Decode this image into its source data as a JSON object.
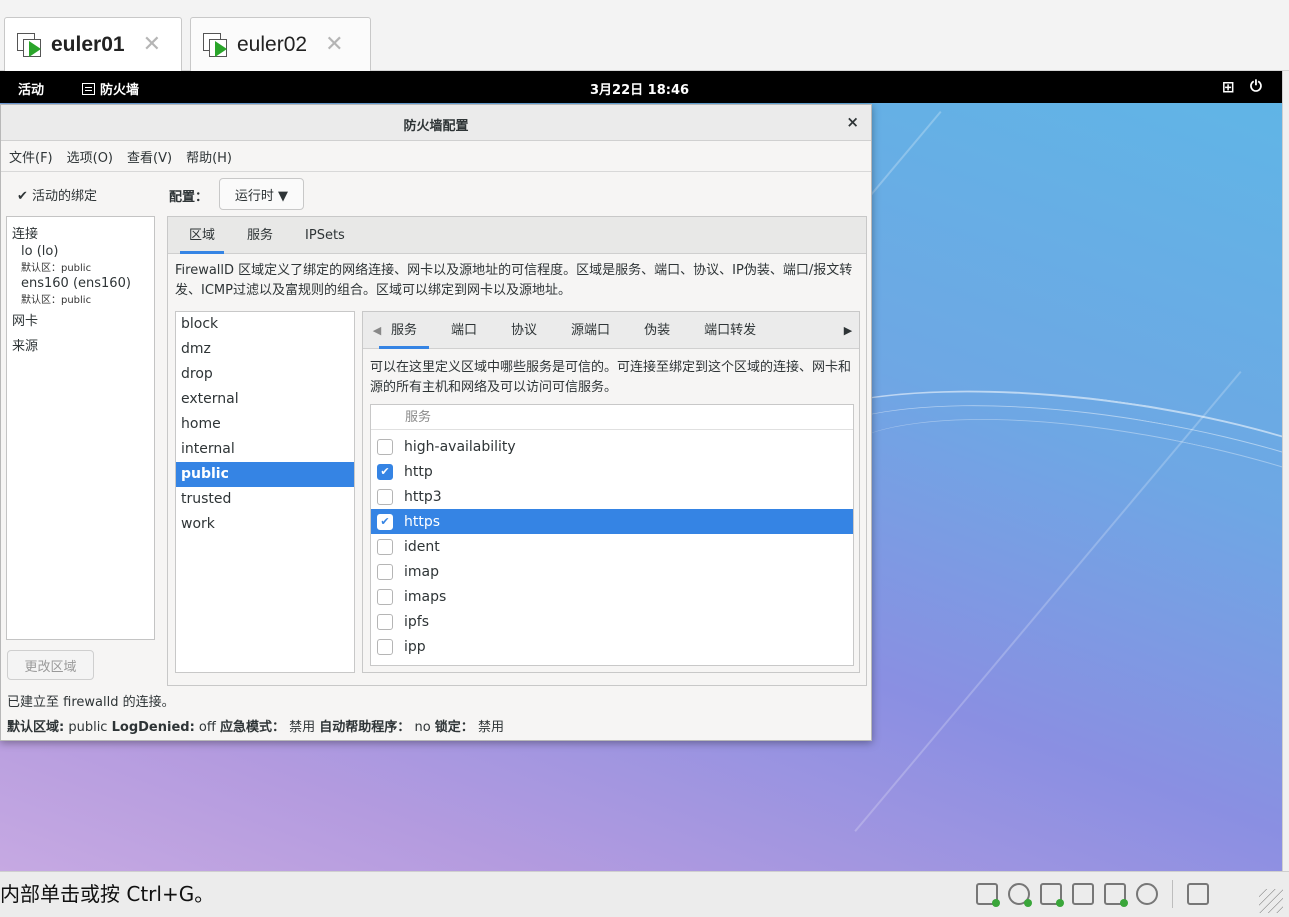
{
  "host_tabs": [
    {
      "label": "euler01",
      "active": true
    },
    {
      "label": "euler02",
      "active": false
    }
  ],
  "topbar": {
    "activities": "活动",
    "app_name": "防火墙",
    "clock": "3月22日 18:46",
    "network_icon": "network-icon",
    "power_icon": "power-icon"
  },
  "window": {
    "title": "防火墙配置",
    "close_glyph": "×",
    "menu": [
      "文件(F)",
      "选项(O)",
      "查看(V)",
      "帮助(H)"
    ],
    "binding_toggle": "✔ 活动的绑定",
    "connections_header": "连接",
    "connections": [
      {
        "name": "lo (lo)",
        "zone": "默认区：public"
      },
      {
        "name": "ens160 (ens160)",
        "zone": "默认区：public"
      }
    ],
    "nic_header": "网卡",
    "source_header": "来源",
    "change_zone_button": "更改区域",
    "config_label": "配置：",
    "config_value": "运行时 ▼",
    "top_tabs": [
      "区域",
      "服务",
      "IPSets"
    ],
    "zone_description": "FirewallD 区域定义了绑定的网络连接、网卡以及源地址的可信程度。区域是服务、端口、协议、IP伪装、端口/报文转发、ICMP过滤以及富规则的组合。区域可以绑定到网卡以及源地址。",
    "zones": [
      "block",
      "dmz",
      "drop",
      "external",
      "home",
      "internal",
      "public",
      "trusted",
      "work"
    ],
    "selected_zone": "public",
    "inner_tabs": [
      "服务",
      "端口",
      "协议",
      "源端口",
      "伪装",
      "端口转发"
    ],
    "service_description": "可以在这里定义区域中哪些服务是可信的。可连接至绑定到这个区域的连接、网卡和源的所有主机和网络及可以访问可信服务。",
    "service_column_header": "服务",
    "services": [
      {
        "name": "high-availability",
        "checked": false,
        "selected": false
      },
      {
        "name": "http",
        "checked": true,
        "selected": false
      },
      {
        "name": "http3",
        "checked": false,
        "selected": false
      },
      {
        "name": "https",
        "checked": true,
        "selected": true
      },
      {
        "name": "ident",
        "checked": false,
        "selected": false
      },
      {
        "name": "imap",
        "checked": false,
        "selected": false
      },
      {
        "name": "imaps",
        "checked": false,
        "selected": false
      },
      {
        "name": "ipfs",
        "checked": false,
        "selected": false
      },
      {
        "name": "ipp",
        "checked": false,
        "selected": false
      }
    ],
    "status_line": "已建立至 firewalld 的连接。",
    "status_default_zone_label": "默认区域:",
    "status_default_zone": "public",
    "status_logdenied_label": "LogDenied:",
    "status_logdenied": "off",
    "status_panic_label": "应急模式：",
    "status_panic": "禁用",
    "status_helper_label": "自动帮助程序：",
    "status_helper": "no",
    "status_lock_label": "锁定：",
    "status_lock": "禁用"
  },
  "host_status": {
    "hint": "内部单击或按 Ctrl+G。",
    "tray_icons": [
      "hdd-icon",
      "cd-icon",
      "network-adapter-icon",
      "printer-icon",
      "sound-icon",
      "usb-icon",
      "message-icon"
    ]
  },
  "colors": {
    "accent": "#3584e4",
    "topbar": "#000000",
    "vm_play": "#2aa52a"
  }
}
